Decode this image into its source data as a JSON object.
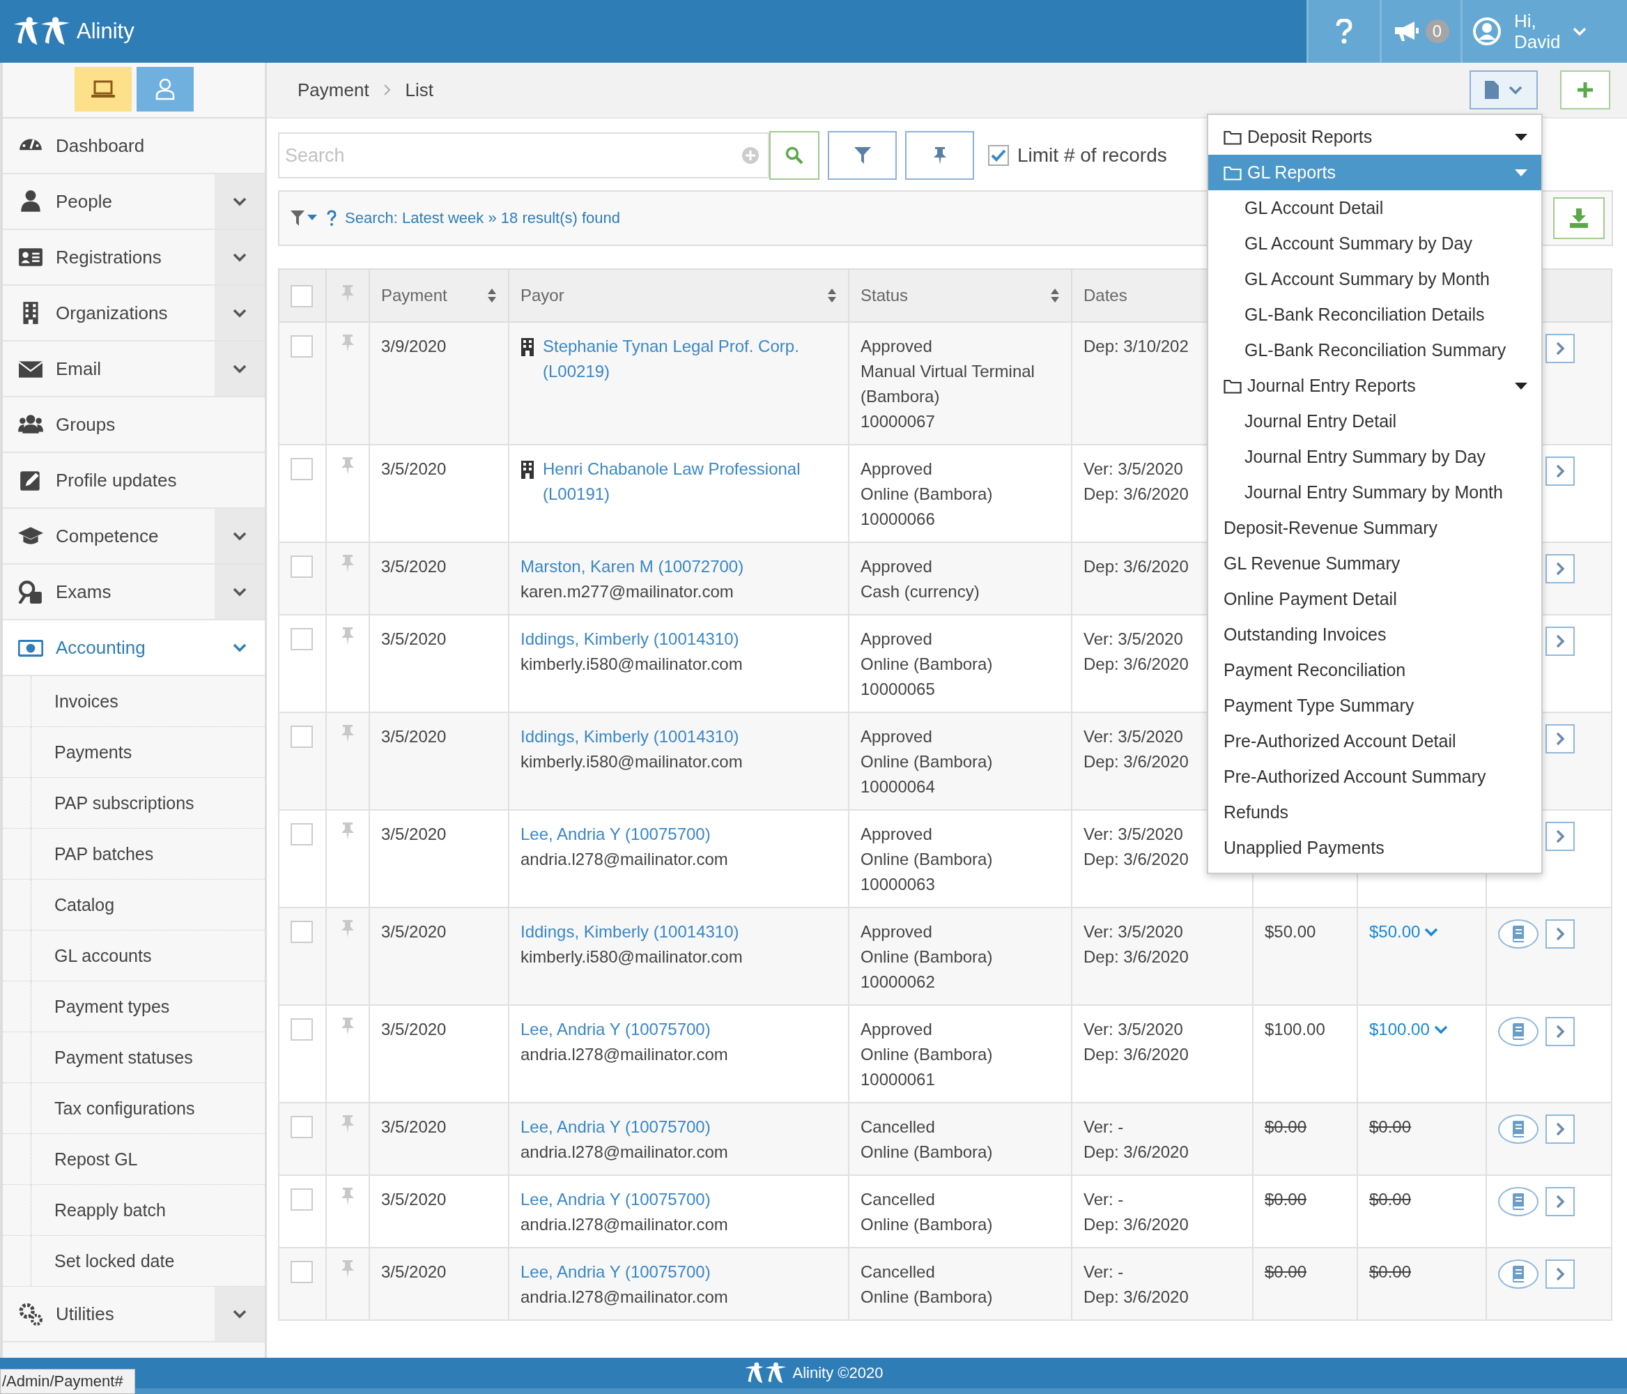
{
  "header": {
    "brand": "Alinity",
    "notifications": "0",
    "greeting": [
      "Hi,",
      "David"
    ]
  },
  "sidebar": {
    "items": [
      {
        "label": "Dashboard",
        "selected": false,
        "kind": "link"
      },
      {
        "label": "People",
        "selected": false,
        "kind": "group"
      },
      {
        "label": "Registrations",
        "selected": false,
        "kind": "group"
      },
      {
        "label": "Organizations",
        "selected": false,
        "kind": "group"
      },
      {
        "label": "Email",
        "selected": false,
        "kind": "group"
      },
      {
        "label": "Groups",
        "selected": false,
        "kind": "link"
      },
      {
        "label": "Profile updates",
        "selected": false,
        "kind": "link"
      },
      {
        "label": "Competence",
        "selected": false,
        "kind": "group"
      },
      {
        "label": "Exams",
        "selected": false,
        "kind": "group"
      },
      {
        "label": "Accounting",
        "selected": true,
        "kind": "group",
        "children": [
          {
            "label": "Invoices"
          },
          {
            "label": "Payments"
          },
          {
            "label": "PAP subscriptions"
          },
          {
            "label": "PAP batches"
          },
          {
            "label": "Catalog"
          },
          {
            "label": "GL accounts"
          },
          {
            "label": "Payment types"
          },
          {
            "label": "Payment statuses"
          },
          {
            "label": "Tax configurations"
          },
          {
            "label": "Repost GL"
          },
          {
            "label": "Reapply batch"
          },
          {
            "label": "Set locked date"
          }
        ]
      },
      {
        "label": "Utilities",
        "selected": false,
        "kind": "group"
      }
    ]
  },
  "breadcrumb": [
    "Payment",
    "List"
  ],
  "toolbar": {
    "search": {
      "placeholder": "Search"
    },
    "limit": {
      "label": "Limit # of records",
      "checked": true
    }
  },
  "filter_summary": "Search: Latest week » 18 result(s) found",
  "table": {
    "all_selected": false,
    "columns": [
      {
        "label": "Payment",
        "sortable": true
      },
      {
        "label": "Payor",
        "sortable": true
      },
      {
        "label": "Status",
        "sortable": true
      },
      {
        "label": "Dates"
      }
    ],
    "rows": [
      {
        "selected": false,
        "payment": "3/9/2020",
        "payor": {
          "kind": "organization",
          "name": "Stephanie Tynan Legal Prof. Corp. (L00219)"
        },
        "status": [
          "Approved",
          "Manual Virtual Terminal (Bambora)",
          "10000067"
        ],
        "dates": [
          "Dep: 3/10/202"
        ]
      },
      {
        "selected": false,
        "payment": "3/5/2020",
        "payor": {
          "kind": "organization",
          "name": "Henri Chabanole Law Professional (L00191)"
        },
        "status": [
          "Approved",
          "Online (Bambora)",
          "10000066"
        ],
        "dates": [
          "Ver: 3/5/2020",
          "Dep: 3/6/2020"
        ]
      },
      {
        "selected": false,
        "payment": "3/5/2020",
        "payor": {
          "kind": "person",
          "name": "Marston, Karen M (10072700)",
          "email": "karen.m277@mailinator.com"
        },
        "status": [
          "Approved",
          "Cash (currency)"
        ],
        "dates": [
          "Dep: 3/6/2020"
        ]
      },
      {
        "selected": false,
        "payment": "3/5/2020",
        "payor": {
          "kind": "person",
          "name": "Iddings, Kimberly (10014310)",
          "email": "kimberly.i580@mailinator.com"
        },
        "status": [
          "Approved",
          "Online (Bambora)",
          "10000065"
        ],
        "dates": [
          "Ver: 3/5/2020",
          "Dep: 3/6/2020"
        ]
      },
      {
        "selected": false,
        "payment": "3/5/2020",
        "payor": {
          "kind": "person",
          "name": "Iddings, Kimberly (10014310)",
          "email": "kimberly.i580@mailinator.com"
        },
        "status": [
          "Approved",
          "Online (Bambora)",
          "10000064"
        ],
        "dates": [
          "Ver: 3/5/2020",
          "Dep: 3/6/2020"
        ]
      },
      {
        "selected": false,
        "payment": "3/5/2020",
        "payor": {
          "kind": "person",
          "name": "Lee, Andria Y (10075700)",
          "email": "andria.l278@mailinator.com"
        },
        "status": [
          "Approved",
          "Online (Bambora)",
          "10000063"
        ],
        "dates": [
          "Ver: 3/5/2020",
          "Dep: 3/6/2020"
        ]
      },
      {
        "selected": false,
        "payment": "3/5/2020",
        "payor": {
          "kind": "person",
          "name": "Iddings, Kimberly (10014310)",
          "email": "kimberly.i580@mailinator.com"
        },
        "status": [
          "Approved",
          "Online (Bambora)",
          "10000062"
        ],
        "dates": [
          "Ver: 3/5/2020",
          "Dep: 3/6/2020"
        ],
        "amount": {
          "text": "$50.00",
          "struck": false
        },
        "paid": {
          "text": "$50.00",
          "kind": "link",
          "struck": false
        }
      },
      {
        "selected": false,
        "payment": "3/5/2020",
        "payor": {
          "kind": "person",
          "name": "Lee, Andria Y (10075700)",
          "email": "andria.l278@mailinator.com"
        },
        "status": [
          "Approved",
          "Online (Bambora)",
          "10000061"
        ],
        "dates": [
          "Ver: 3/5/2020",
          "Dep: 3/6/2020"
        ],
        "amount": {
          "text": "$100.00",
          "struck": false
        },
        "paid": {
          "text": "$100.00",
          "kind": "link",
          "struck": false
        }
      },
      {
        "selected": false,
        "payment": "3/5/2020",
        "payor": {
          "kind": "person",
          "name": "Lee, Andria Y (10075700)",
          "email": "andria.l278@mailinator.com"
        },
        "status": [
          "Cancelled",
          "Online (Bambora)"
        ],
        "dates": [
          "Ver: -",
          "Dep: 3/6/2020"
        ],
        "amount": {
          "text": "$0.00",
          "struck": true
        },
        "paid": {
          "text": "$0.00",
          "kind": "plain",
          "struck": true
        }
      },
      {
        "selected": false,
        "payment": "3/5/2020",
        "payor": {
          "kind": "person",
          "name": "Lee, Andria Y (10075700)",
          "email": "andria.l278@mailinator.com"
        },
        "status": [
          "Cancelled",
          "Online (Bambora)"
        ],
        "dates": [
          "Ver: -",
          "Dep: 3/6/2020"
        ],
        "amount": {
          "text": "$0.00",
          "struck": true
        },
        "paid": {
          "text": "$0.00",
          "kind": "plain",
          "struck": true
        }
      },
      {
        "selected": false,
        "payment": "3/5/2020",
        "payor": {
          "kind": "person",
          "name": "Lee, Andria Y (10075700)",
          "email": "andria.l278@mailinator.com"
        },
        "status": [
          "Cancelled",
          "Online (Bambora)"
        ],
        "dates": [
          "Ver: -",
          "Dep: 3/6/2020"
        ],
        "amount": {
          "text": "$0.00",
          "struck": true
        },
        "paid": {
          "text": "$0.00",
          "kind": "plain",
          "struck": true
        }
      }
    ]
  },
  "reports_menu": {
    "items": [
      {
        "kind": "folder",
        "label": "Deposit Reports",
        "selected": false
      },
      {
        "kind": "folder",
        "label": "GL Reports",
        "selected": true,
        "children": [
          {
            "label": "GL Account Detail",
            "selected": false
          },
          {
            "label": "GL Account Summary by Day",
            "selected": false
          },
          {
            "label": "GL Account Summary by Month",
            "selected": false
          },
          {
            "label": "GL-Bank Reconciliation Details",
            "selected": false
          },
          {
            "label": "GL-Bank Reconciliation Summary",
            "selected": false
          }
        ]
      },
      {
        "kind": "folder",
        "label": "Journal Entry Reports",
        "selected": false,
        "children": [
          {
            "label": "Journal Entry Detail",
            "selected": false
          },
          {
            "label": "Journal Entry Summary by Day",
            "selected": false
          },
          {
            "label": "Journal Entry Summary by Month",
            "selected": false
          }
        ]
      },
      {
        "kind": "report",
        "label": "Deposit-Revenue Summary",
        "selected": false
      },
      {
        "kind": "report",
        "label": "GL Revenue Summary",
        "selected": false
      },
      {
        "kind": "report",
        "label": "Online Payment Detail",
        "selected": false
      },
      {
        "kind": "report",
        "label": "Outstanding Invoices",
        "selected": false
      },
      {
        "kind": "report",
        "label": "Payment Reconciliation",
        "selected": false
      },
      {
        "kind": "report",
        "label": "Payment Type Summary",
        "selected": false
      },
      {
        "kind": "report",
        "label": "Pre-Authorized Account Detail",
        "selected": false
      },
      {
        "kind": "report",
        "label": "Pre-Authorized Account Summary",
        "selected": false
      },
      {
        "kind": "report",
        "label": "Refunds",
        "selected": false
      },
      {
        "kind": "report",
        "label": "Unapplied Payments",
        "selected": false
      }
    ]
  },
  "footer": {
    "text": "Alinity ©2020"
  },
  "status_url": "/Admin/Payment#"
}
